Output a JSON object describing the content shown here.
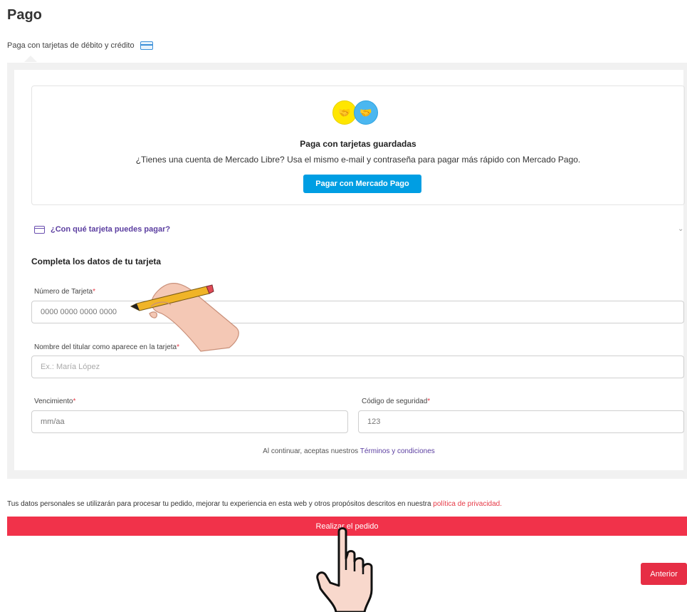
{
  "page": {
    "title": "Pago",
    "method_tab": "Paga con tarjetas de débito y crédito"
  },
  "saved_cards": {
    "title": "Paga con tarjetas guardadas",
    "description": "¿Tienes una cuenta de Mercado Libre? Usa el mismo e-mail y contraseña para pagar más rápido con Mercado Pago.",
    "button_label": "Pagar con Mercado Pago"
  },
  "which_card": {
    "label": "¿Con qué tarjeta puedes pagar?"
  },
  "form": {
    "title": "Completa los datos de tu tarjeta",
    "card_number": {
      "label": "Número de Tarjeta",
      "placeholder": "0000 0000 0000 0000"
    },
    "holder_name": {
      "label": "Nombre del titular como aparece en la tarjeta",
      "placeholder": "Ex.: María López"
    },
    "expiry": {
      "label": "Vencimiento",
      "placeholder": "mm/aa"
    },
    "cvv": {
      "label": "Código de seguridad",
      "placeholder": "123"
    },
    "required_mark": "*"
  },
  "terms": {
    "prefix": "Al continuar, aceptas nuestros",
    "link": "Términos y condiciones"
  },
  "privacy": {
    "text": "Tus datos personales se utilizarán para procesar tu pedido, mejorar tu experiencia en esta web y otros propósitos descritos en nuestra",
    "link": "política de privacidad."
  },
  "actions": {
    "order_label": "Realizar el pedido",
    "back_label": "Anterior"
  },
  "colors": {
    "primary_red": "#f1324a",
    "mercado_pago_blue": "#009ee3",
    "link_purple": "#5b3ea0"
  }
}
